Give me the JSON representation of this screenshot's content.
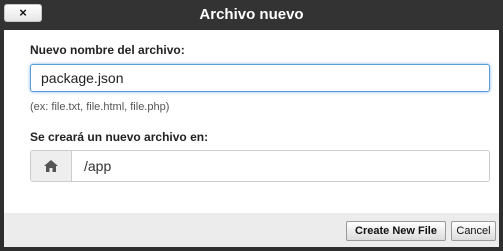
{
  "dialog": {
    "title": "Archivo nuevo",
    "close_label": "×"
  },
  "filename": {
    "label": "Nuevo nombre del archivo:",
    "value": "package.json",
    "hint": "(ex: file.txt, file.html, file.php)"
  },
  "location": {
    "label": "Se creará un nuevo archivo en:",
    "icon": "home-icon",
    "value": "/app"
  },
  "buttons": {
    "create_label": "Create New File",
    "cancel_label": "Cancel"
  }
}
